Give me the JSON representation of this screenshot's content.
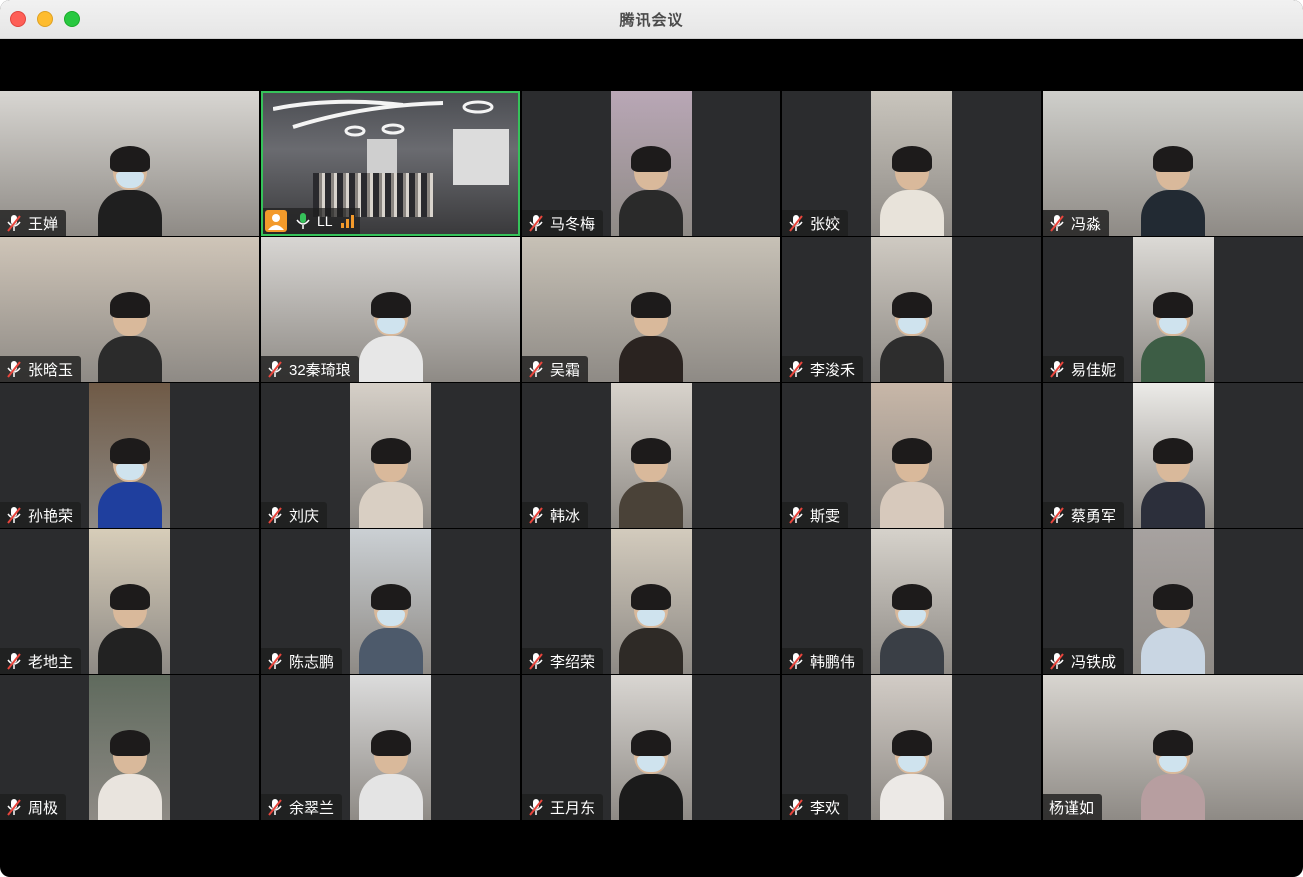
{
  "window": {
    "title": "腾讯会议"
  },
  "self_tile": {
    "name": "LL"
  },
  "participants": [
    {
      "name": "王婵",
      "row": 0,
      "col": 0,
      "shirt": "#1f1f1f",
      "bg": "#d8d6d2",
      "mask": true,
      "wide": true
    },
    {
      "name": "马冬梅",
      "row": 0,
      "col": 2,
      "shirt": "#2a2a2a",
      "bg": "#b9a7b6",
      "mask": false,
      "wide": false
    },
    {
      "name": "张姣",
      "row": 0,
      "col": 3,
      "shirt": "#e8e3da",
      "bg": "#c9c5bd",
      "mask": false,
      "wide": false
    },
    {
      "name": "冯淼",
      "row": 0,
      "col": 4,
      "shirt": "#222a33",
      "bg": "#cfcfcb",
      "mask": false,
      "wide": true
    },
    {
      "name": "张晗玉",
      "row": 1,
      "col": 0,
      "shirt": "#2b2b2b",
      "bg": "#cfc5b8",
      "mask": false,
      "wide": true
    },
    {
      "name": "32秦琦琅",
      "row": 1,
      "col": 1,
      "shirt": "#e7e7e7",
      "bg": "#d8d6d3",
      "mask": true,
      "wide": true
    },
    {
      "name": "吴霜",
      "row": 1,
      "col": 2,
      "shirt": "#2a2320",
      "bg": "#c7c1b6",
      "mask": false,
      "wide": true
    },
    {
      "name": "李浚禾",
      "row": 1,
      "col": 3,
      "shirt": "#2d2d2d",
      "bg": "#cfcac2",
      "mask": true,
      "wide": false
    },
    {
      "name": "易佳妮",
      "row": 1,
      "col": 4,
      "shirt": "#3d5d45",
      "bg": "#dcdad6",
      "mask": true,
      "wide": false
    },
    {
      "name": "孙艳荣",
      "row": 2,
      "col": 0,
      "shirt": "#1f3f9e",
      "bg": "#6f5a46",
      "mask": true,
      "wide": false
    },
    {
      "name": "刘庆",
      "row": 2,
      "col": 1,
      "shirt": "#d9cfc3",
      "bg": "#d6d0c8",
      "mask": false,
      "wide": false
    },
    {
      "name": "韩冰",
      "row": 2,
      "col": 2,
      "shirt": "#4a4238",
      "bg": "#d8d3cc",
      "mask": false,
      "wide": false
    },
    {
      "name": "斯雯",
      "row": 2,
      "col": 3,
      "shirt": "#d7c9bc",
      "bg": "#c8b7a8",
      "mask": false,
      "wide": false
    },
    {
      "name": "蔡勇军",
      "row": 2,
      "col": 4,
      "shirt": "#2c2f3b",
      "bg": "#ecebe8",
      "mask": false,
      "wide": false
    },
    {
      "name": "老地主",
      "row": 3,
      "col": 0,
      "shirt": "#222222",
      "bg": "#d7cdb9",
      "mask": false,
      "wide": false
    },
    {
      "name": "陈志鹏",
      "row": 3,
      "col": 1,
      "shirt": "#4d5a6b",
      "bg": "#cbd0d4",
      "mask": true,
      "wide": false
    },
    {
      "name": "李绍荣",
      "row": 3,
      "col": 2,
      "shirt": "#2e2a26",
      "bg": "#d3cbbd",
      "mask": true,
      "wide": false
    },
    {
      "name": "韩鹏伟",
      "row": 3,
      "col": 3,
      "shirt": "#3a3f46",
      "bg": "#d6d2cb",
      "mask": true,
      "wide": false
    },
    {
      "name": "冯铁成",
      "row": 3,
      "col": 4,
      "shirt": "#c9d6e3",
      "bg": "#a7a2a0",
      "mask": false,
      "wide": false
    },
    {
      "name": "周极",
      "row": 4,
      "col": 0,
      "shirt": "#e9e4de",
      "bg": "#5f6a5d",
      "mask": false,
      "wide": false
    },
    {
      "name": "余翠兰",
      "row": 4,
      "col": 1,
      "shirt": "#e4e4e4",
      "bg": "#dcdcdc",
      "mask": false,
      "wide": false
    },
    {
      "name": "王月东",
      "row": 4,
      "col": 2,
      "shirt": "#1b1b1b",
      "bg": "#d9d6d2",
      "mask": true,
      "wide": false
    },
    {
      "name": "李欢",
      "row": 4,
      "col": 3,
      "shirt": "#ece9e6",
      "bg": "#d2ccc6",
      "mask": true,
      "wide": false
    },
    {
      "name": "杨谨如",
      "row": 4,
      "col": 4,
      "shirt": "#b79ea0",
      "bg": "#d8d5d0",
      "mask": true,
      "wide": true,
      "no_mic": true
    }
  ],
  "colors": {
    "active_border": "#36c25a",
    "tile_bg": "#2b2c2e",
    "self_icon": "#f39a2b"
  },
  "icons": {
    "muted_mic": "mic-muted-icon",
    "active_mic": "mic-active-icon"
  }
}
